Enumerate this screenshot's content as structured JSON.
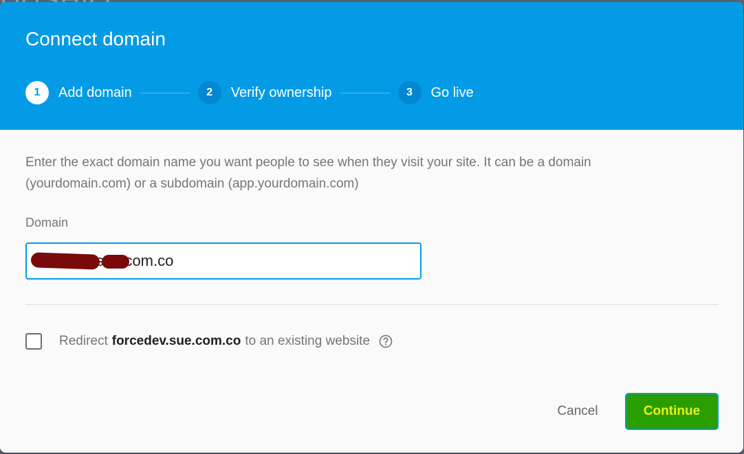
{
  "dialog": {
    "title": "Connect domain",
    "steps": [
      {
        "number": "1",
        "label": "Add domain",
        "active": true
      },
      {
        "number": "2",
        "label": "Verify ownership",
        "active": false
      },
      {
        "number": "3",
        "label": "Go live",
        "active": false
      }
    ],
    "description": "Enter the exact domain name you want people to see when they visit your site. It can be a domain (yourdomain.com) or a subdomain (app.yourdomain.com)",
    "domain_field": {
      "label": "Domain",
      "value": "forcedev.sue.com.co"
    },
    "redirect": {
      "prefix": "Redirect",
      "domain": "forcedev.sue.com.co",
      "suffix": "to an existing website",
      "help_icon": "help-circle-icon"
    },
    "actions": {
      "cancel_label": "Cancel",
      "continue_label": "Continue"
    },
    "colors": {
      "header": "#039be5",
      "continue_bg": "#2a9d00",
      "continue_text": "#e8f21b"
    }
  }
}
